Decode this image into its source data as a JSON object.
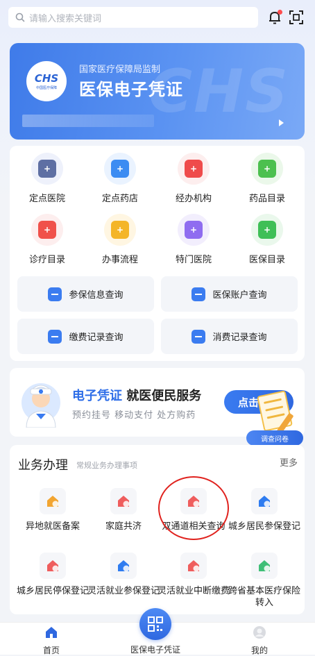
{
  "search": {
    "placeholder": "请输入搜索关键词"
  },
  "banner": {
    "logo_text": "CHS",
    "logo_sub": "中国医疗保障",
    "supervisor": "国家医疗保障局监制",
    "title": "医保电子凭证",
    "watermark": "CHS"
  },
  "services": {
    "grid": [
      {
        "label": "定点医院",
        "icon": "hospital-icon",
        "color": "#5e6fa3",
        "bg": "#eef1fb"
      },
      {
        "label": "定点药店",
        "icon": "pharmacy-icon",
        "color": "#3c8cf2",
        "bg": "#eaf3ff"
      },
      {
        "label": "经办机构",
        "icon": "institution-icon",
        "color": "#ef4b4b",
        "bg": "#fdeeee"
      },
      {
        "label": "药品目录",
        "icon": "pill-icon",
        "color": "#4cc04f",
        "bg": "#ebf8ea"
      },
      {
        "label": "诊疗目录",
        "icon": "treatment-icon",
        "color": "#f0514a",
        "bg": "#fdeeee"
      },
      {
        "label": "办事流程",
        "icon": "process-icon",
        "color": "#f4b528",
        "bg": "#fff6e2"
      },
      {
        "label": "特门医院",
        "icon": "heart-icon",
        "color": "#8f6cf0",
        "bg": "#f2eefd"
      },
      {
        "label": "医保目录",
        "icon": "catalog-icon",
        "color": "#3fbf57",
        "bg": "#eaf8ec"
      }
    ],
    "quick": [
      {
        "label": "参保信息查询",
        "icon": "insurance-info-icon",
        "color": "#3b7cf0"
      },
      {
        "label": "医保账户查询",
        "icon": "account-icon",
        "color": "#3b7cf0"
      },
      {
        "label": "缴费记录查询",
        "icon": "payment-icon",
        "color": "#3b7cf0"
      },
      {
        "label": "消费记录查询",
        "icon": "yuan-icon",
        "color": "#3b7cf0"
      }
    ]
  },
  "promo": {
    "title_blue": "电子凭证",
    "title_rest": " 就医便民服务",
    "subtitle": "预约挂号  移动支付  处方购药",
    "button": "点击查",
    "survey": "调查问卷"
  },
  "business": {
    "title": "业务办理",
    "subtitle": "常规业务办理事项",
    "more": "更多",
    "items": [
      {
        "label": "异地就医备案",
        "icon": "remote-icon",
        "color": "#f2a531"
      },
      {
        "label": "家庭共济",
        "icon": "family-icon",
        "color": "#ef5d5d"
      },
      {
        "label": "双通道相关查询",
        "icon": "dual-channel-icon",
        "color": "#ef5d5d"
      },
      {
        "label": "城乡居民参保登记",
        "icon": "enroll-icon",
        "color": "#2f7cf0"
      },
      {
        "label": "城乡居民停保登记",
        "icon": "stop-icon",
        "color": "#ef5d5d"
      },
      {
        "label": "灵活就业参保登记",
        "icon": "flex-enroll-icon",
        "color": "#2f7cf0"
      },
      {
        "label": "灵活就业中断缴费",
        "icon": "flex-stop-icon",
        "color": "#ef5d5d"
      },
      {
        "label": "跨省基本医疗保险转入",
        "icon": "transfer-icon",
        "color": "#3fbf77"
      }
    ]
  },
  "tabs": {
    "home": "首页",
    "center": "医保电子凭证",
    "mine": "我的"
  },
  "colors": {
    "accent": "#2f68e0",
    "highlight": "#e0221e"
  }
}
